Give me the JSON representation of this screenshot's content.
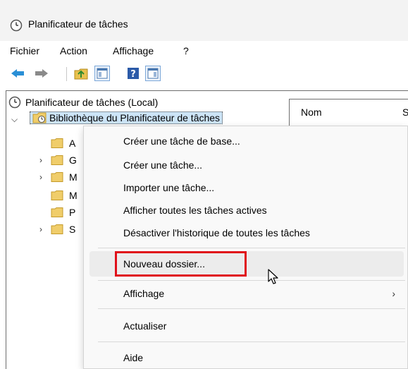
{
  "window": {
    "title": "Planificateur de tâches"
  },
  "menubar": {
    "items": [
      "Fichier",
      "Action",
      "Affichage",
      "?"
    ]
  },
  "toolbar": {
    "buttons": [
      "back-icon",
      "forward-icon",
      "up-folder-icon",
      "show-hide-console-tree-icon",
      "help-icon",
      "show-hide-action-pane-icon"
    ]
  },
  "tree": {
    "root": "Planificateur de tâches (Local)",
    "library": "Bibliothèque du Planificateur de tâches",
    "children": [
      "A",
      "G",
      "M",
      "M",
      "P",
      "S"
    ]
  },
  "columns": [
    "Nom",
    "S"
  ],
  "context_menu": {
    "items": [
      "Créer une tâche de base...",
      "Créer une tâche...",
      "Importer une tâche...",
      "Afficher toutes les tâches actives",
      "Désactiver l'historique de toutes les tâches",
      "Nouveau dossier...",
      "Affichage",
      "Actualiser",
      "Aide"
    ],
    "submenu_arrow": "›"
  },
  "colors": {
    "highlight": "#e0101a",
    "selection": "#cce4f7",
    "menu_bg": "#f9f9f9"
  }
}
